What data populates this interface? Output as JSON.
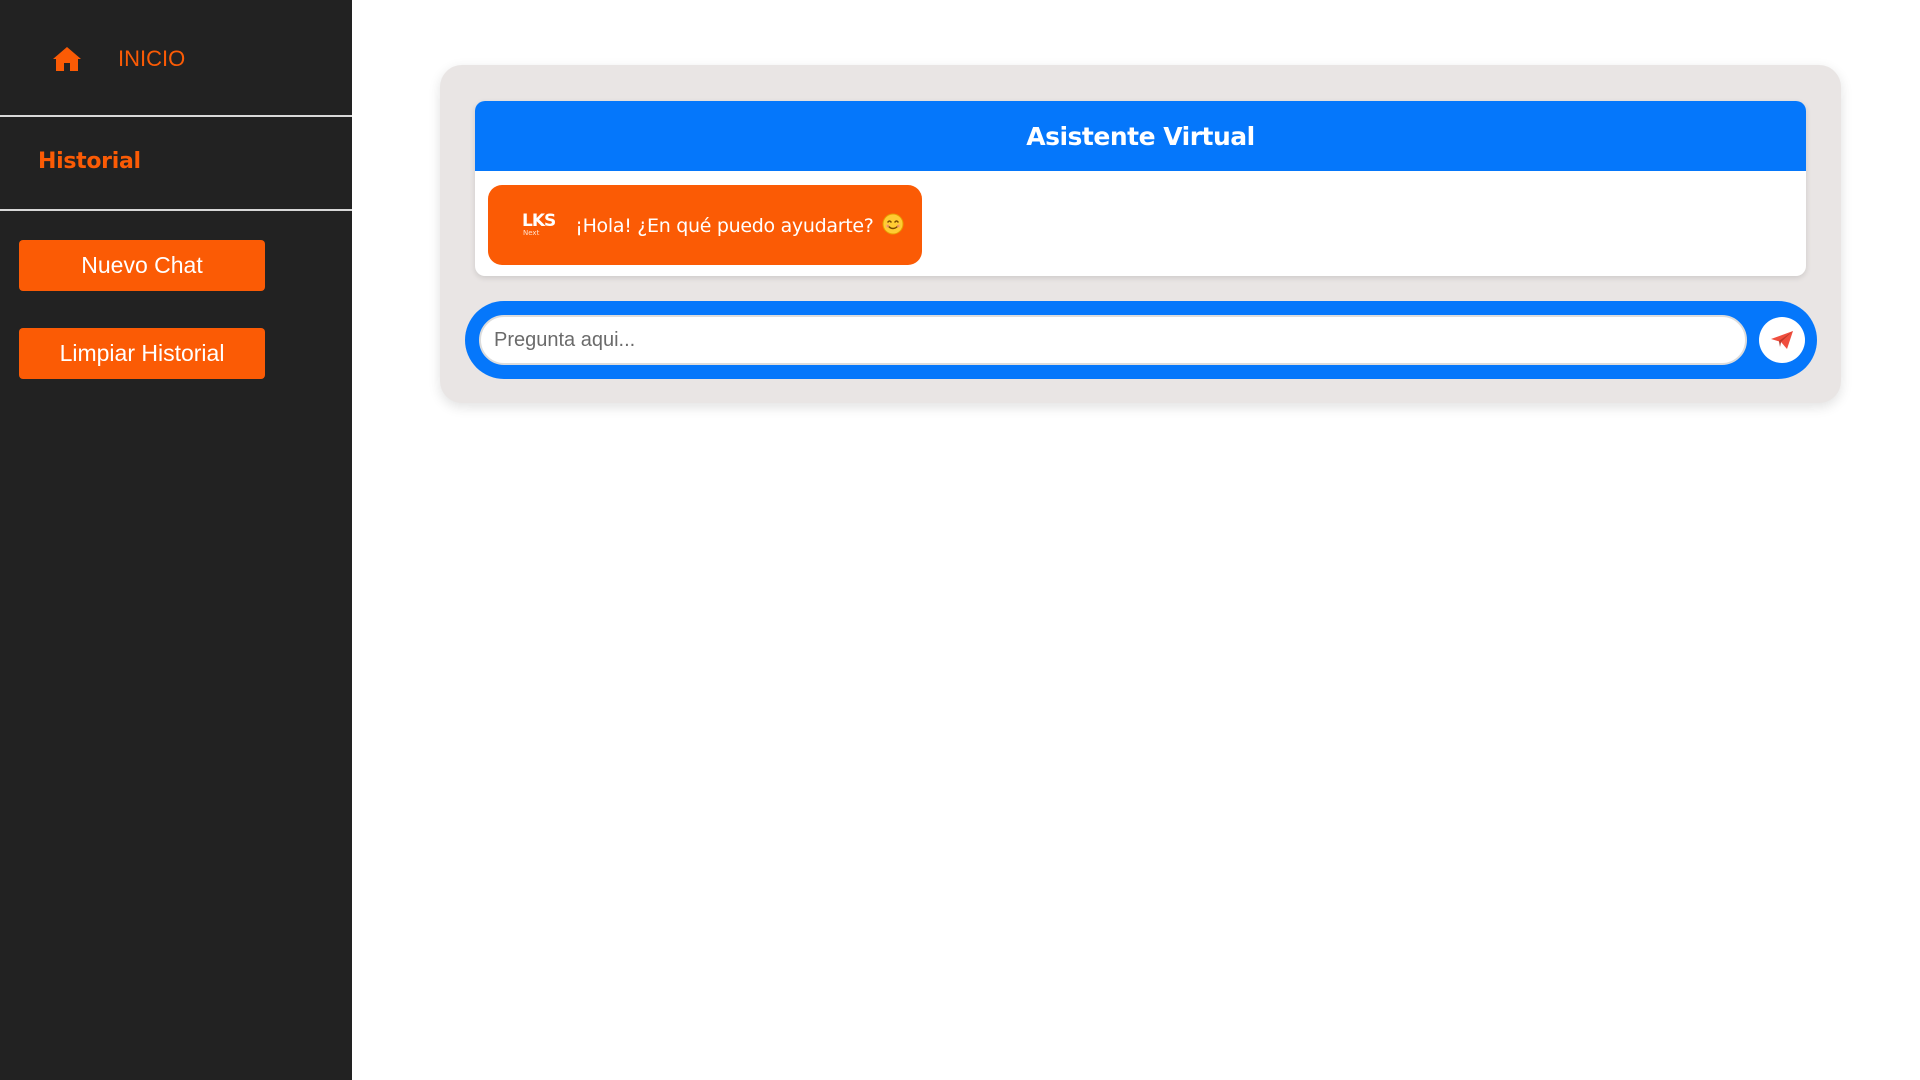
{
  "sidebar": {
    "home_label": "INICIO",
    "home_icon": "home-icon",
    "history_title": "Historial",
    "new_chat_label": "Nuevo Chat",
    "clear_history_label": "Limpiar Historial"
  },
  "chat": {
    "title": "Asistente Virtual",
    "messages": [
      {
        "sender": "bot",
        "avatar": "LKS",
        "avatar_sub": "Next",
        "text": "¡Hola! ¿En qué puedo ayudarte?"
      }
    ],
    "input_placeholder": "Pregunta aqui...",
    "send_icon": "send-icon"
  },
  "colors": {
    "accent_orange": "#fb5b05",
    "accent_blue": "#0577fb",
    "sidebar_bg": "#222222",
    "shell_bg": "#e9e5e4"
  }
}
